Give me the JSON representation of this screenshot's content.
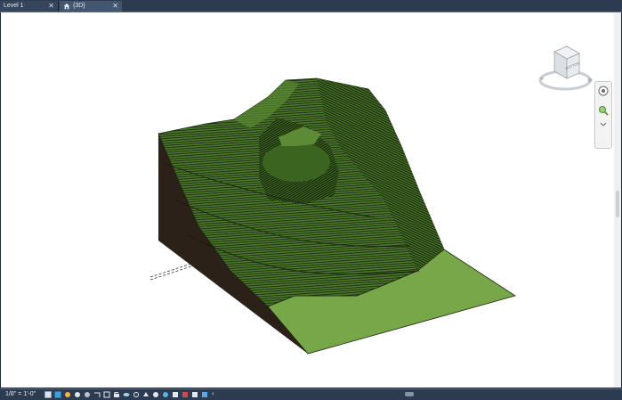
{
  "tabs": [
    {
      "label": "Level 1",
      "close": "✕"
    },
    {
      "label": "{3D}",
      "close": "✕"
    }
  ],
  "viewcube": {
    "face_label": "BOTTOM",
    "icon": "viewcube-icon"
  },
  "navigation_bar": {
    "icons": [
      "full-navigation-wheel-icon",
      "zoom-icon",
      "navbar-menu-chevron-icon"
    ]
  },
  "statusbar": {
    "scale": "1/8\" = 1'-0\"",
    "icons": [
      "detail-level-icon",
      "visual-style-icon",
      "sun-path-icon",
      "shadows-icon",
      "rendering-icon",
      "crop-view-icon",
      "show-crop-icon",
      "unlock-3d-icon",
      "temporary-hide-icon",
      "reveal-hidden-icon",
      "worksharing-icon",
      "analytical-model-icon",
      "highlight-displacement-icon",
      "reveal-constraints-icon",
      "workset-icon",
      "design-option-icon",
      "constraint-icon",
      "lock-icon",
      "scroll-left-icon"
    ]
  },
  "colors": {
    "terrain_top": "#4e7a2a",
    "terrain_flat": "#78a74a",
    "terrain_side": "#2b2119",
    "hatch": "#17240e"
  }
}
